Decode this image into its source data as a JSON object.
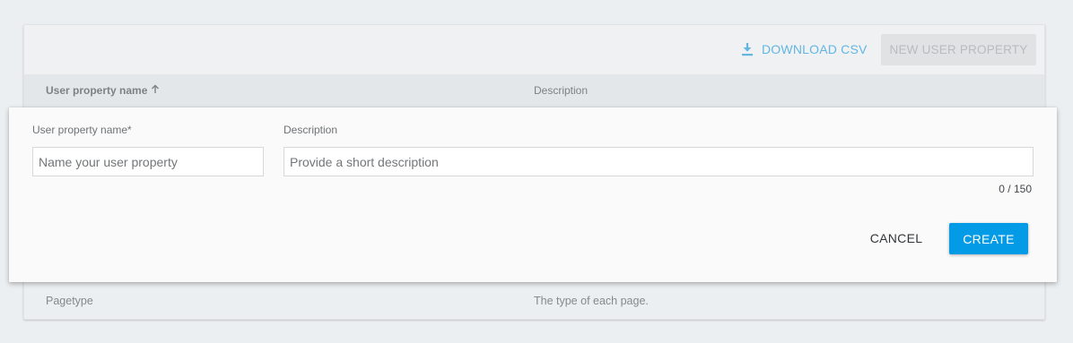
{
  "toolbar": {
    "download_label": "DOWNLOAD CSV",
    "download_icon": "download-icon",
    "new_label": "NEW USER PROPERTY"
  },
  "table": {
    "columns": [
      {
        "label": "User property name",
        "sort_icon": "arrow-up-icon"
      },
      {
        "label": "Description"
      }
    ],
    "rows": [
      {
        "name": "Pagetype",
        "description": "The type of each page."
      }
    ]
  },
  "dialog": {
    "name_label": "User property name",
    "required_marker": "*",
    "name_placeholder": "Name your user property",
    "name_value": "",
    "description_label": "Description",
    "description_placeholder": "Provide a short description",
    "description_value": "",
    "counter": "0 / 150",
    "cancel_label": "CANCEL",
    "create_label": "CREATE"
  },
  "colors": {
    "accent": "#039be5",
    "link": "#64b6e2"
  }
}
